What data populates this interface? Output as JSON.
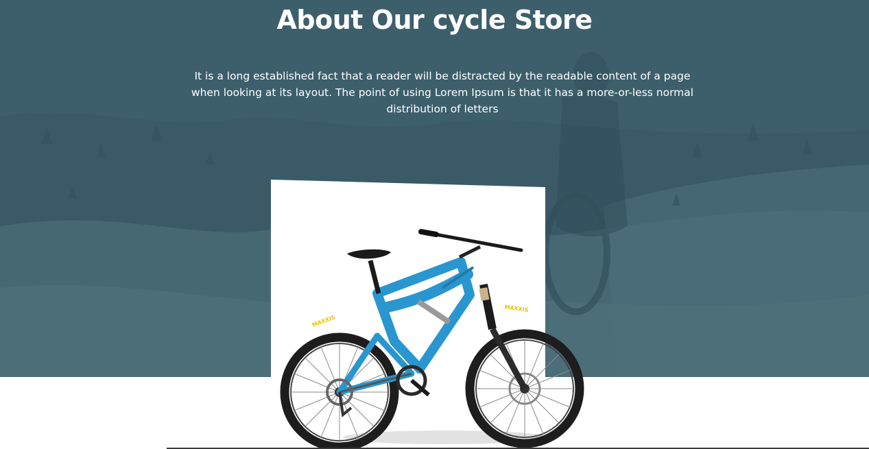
{
  "about": {
    "title": "About Our cycle Store",
    "description": "It is a long established fact that a reader will be distracted by the readable content of a page when looking at its layout. The point of using Lorem Ipsum is that it has a more-or-less normal distribution of letters"
  },
  "bike": {
    "tire_brand": "MAXXIS",
    "frame_color": "#2a96cf"
  },
  "colors": {
    "hero_background": "#3d5f6c",
    "card_background": "#ffffff",
    "text": "#ffffff"
  }
}
